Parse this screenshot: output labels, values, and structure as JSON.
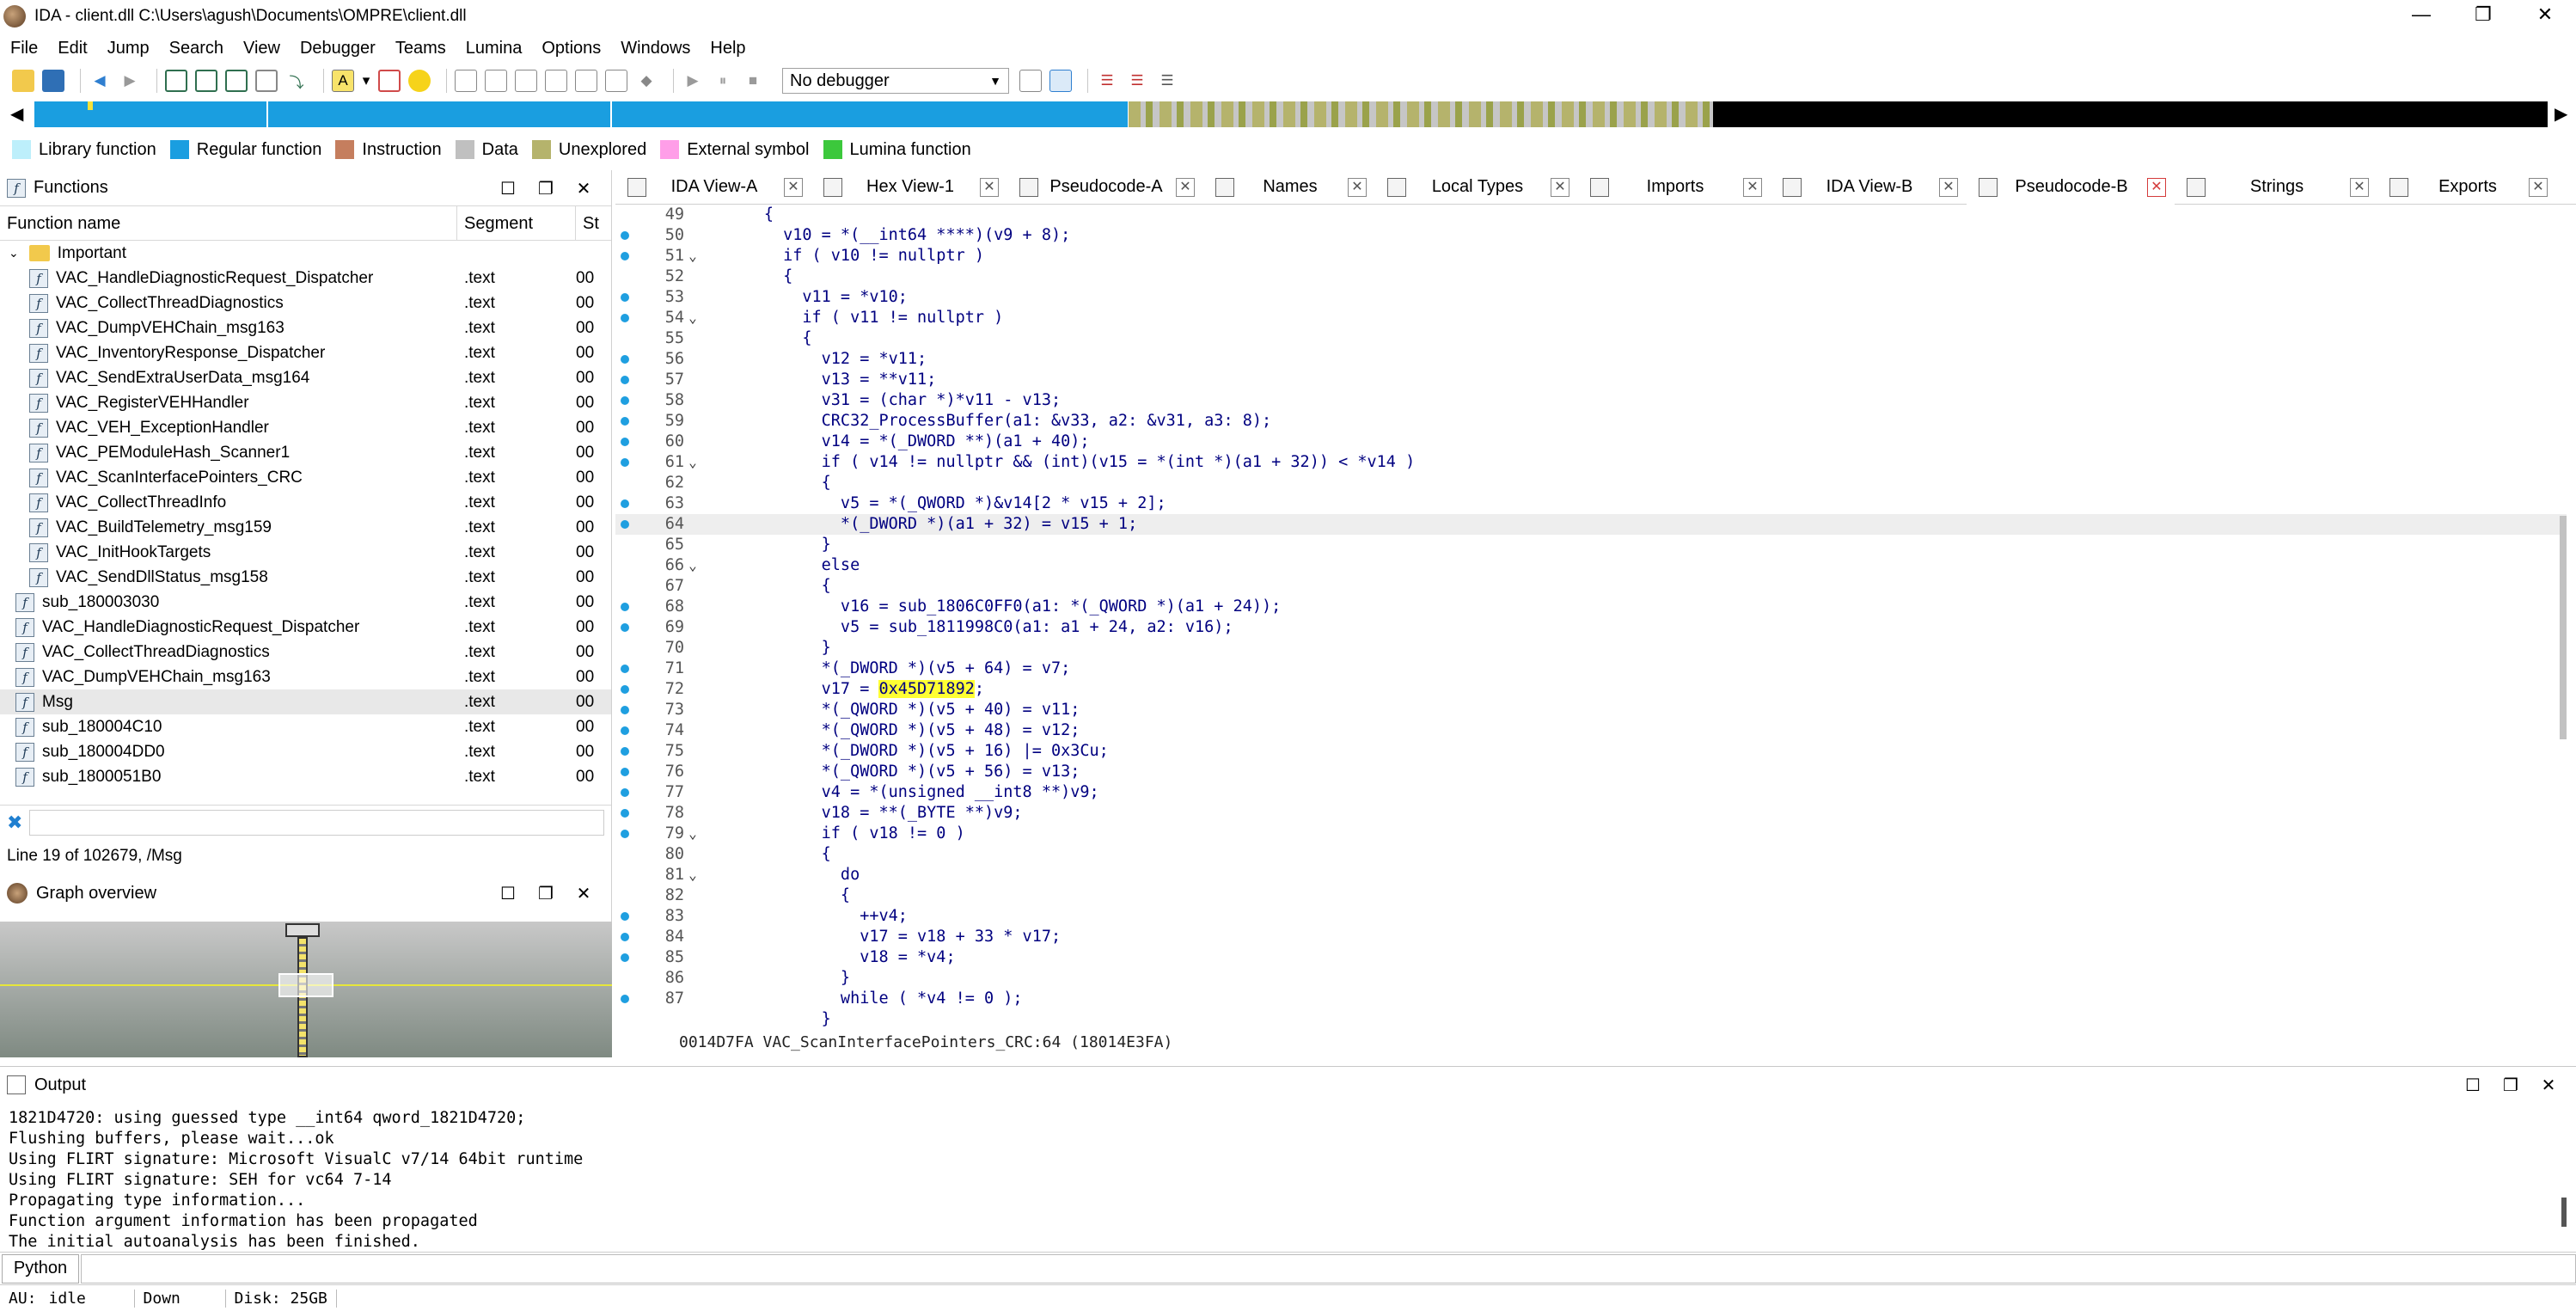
{
  "window": {
    "title": "IDA - client.dll C:\\Users\\agush\\Documents\\OMPRE\\client.dll",
    "controls": [
      "—",
      "❐",
      "✕"
    ]
  },
  "menu": [
    "File",
    "Edit",
    "Jump",
    "Search",
    "View",
    "Debugger",
    "Teams",
    "Lumina",
    "Options",
    "Windows",
    "Help"
  ],
  "toolbar": {
    "debugger_select": "No debugger"
  },
  "legend": [
    {
      "label": "Library function",
      "color": "#bdeffb"
    },
    {
      "label": "Regular function",
      "color": "#1a9ee0"
    },
    {
      "label": "Instruction",
      "color": "#c57e5e"
    },
    {
      "label": "Data",
      "color": "#c0c0c0"
    },
    {
      "label": "Unexplored",
      "color": "#b5b36c"
    },
    {
      "label": "External symbol",
      "color": "#ff9ee8"
    },
    {
      "label": "Lumina function",
      "color": "#3cc83c"
    }
  ],
  "functions_panel": {
    "title": "Functions",
    "columns": [
      "Function name",
      "Segment",
      "St"
    ],
    "folder": "Important",
    "rows": [
      {
        "name": "VAC_HandleDiagnosticRequest_Dispatcher",
        "seg": ".text",
        "st": "00",
        "indent": 2
      },
      {
        "name": "VAC_CollectThreadDiagnostics",
        "seg": ".text",
        "st": "00",
        "indent": 2
      },
      {
        "name": "VAC_DumpVEHChain_msg163",
        "seg": ".text",
        "st": "00",
        "indent": 2
      },
      {
        "name": "VAC_InventoryResponse_Dispatcher",
        "seg": ".text",
        "st": "00",
        "indent": 2
      },
      {
        "name": "VAC_SendExtraUserData_msg164",
        "seg": ".text",
        "st": "00",
        "indent": 2
      },
      {
        "name": "VAC_RegisterVEHHandler",
        "seg": ".text",
        "st": "00",
        "indent": 2
      },
      {
        "name": "VAC_VEH_ExceptionHandler",
        "seg": ".text",
        "st": "00",
        "indent": 2
      },
      {
        "name": "VAC_PEModuleHash_Scanner1",
        "seg": ".text",
        "st": "00",
        "indent": 2
      },
      {
        "name": "VAC_ScanInterfacePointers_CRC",
        "seg": ".text",
        "st": "00",
        "indent": 2
      },
      {
        "name": "VAC_CollectThreadInfo",
        "seg": ".text",
        "st": "00",
        "indent": 2
      },
      {
        "name": "VAC_BuildTelemetry_msg159",
        "seg": ".text",
        "st": "00",
        "indent": 2
      },
      {
        "name": "VAC_InitHookTargets",
        "seg": ".text",
        "st": "00",
        "indent": 2
      },
      {
        "name": "VAC_SendDllStatus_msg158",
        "seg": ".text",
        "st": "00",
        "indent": 2
      },
      {
        "name": "sub_180003030",
        "seg": ".text",
        "st": "00",
        "indent": 1
      },
      {
        "name": "VAC_HandleDiagnosticRequest_Dispatcher",
        "seg": ".text",
        "st": "00",
        "indent": 1
      },
      {
        "name": "VAC_CollectThreadDiagnostics",
        "seg": ".text",
        "st": "00",
        "indent": 1
      },
      {
        "name": "VAC_DumpVEHChain_msg163",
        "seg": ".text",
        "st": "00",
        "indent": 1
      },
      {
        "name": "Msg",
        "seg": ".text",
        "st": "00",
        "indent": 1,
        "selected": true
      },
      {
        "name": "sub_180004C10",
        "seg": ".text",
        "st": "00",
        "indent": 1
      },
      {
        "name": "sub_180004DD0",
        "seg": ".text",
        "st": "00",
        "indent": 1
      },
      {
        "name": "sub_1800051B0",
        "seg": ".text",
        "st": "00",
        "indent": 1
      }
    ],
    "status": "Line 19 of 102679, /Msg"
  },
  "graph_panel": {
    "title": "Graph overview"
  },
  "tabs": [
    {
      "label": "IDA View-A",
      "active": false
    },
    {
      "label": "Hex View-1",
      "active": false
    },
    {
      "label": "Pseudocode-A",
      "active": false
    },
    {
      "label": "Names",
      "active": false
    },
    {
      "label": "Local Types",
      "active": false
    },
    {
      "label": "Imports",
      "active": false
    },
    {
      "label": "IDA View-B",
      "active": false
    },
    {
      "label": "Pseudocode-B",
      "active": true
    },
    {
      "label": "Strings",
      "active": false
    },
    {
      "label": "Exports",
      "active": false
    }
  ],
  "code": [
    {
      "n": "49",
      "dot": false,
      "fold": "",
      "t": "      {"
    },
    {
      "n": "50",
      "dot": true,
      "fold": "",
      "t": "        v10 = *(__int64 ****)(v9 + 8);"
    },
    {
      "n": "51",
      "dot": true,
      "fold": "⌄",
      "t": "        if ( v10 != nullptr )"
    },
    {
      "n": "52",
      "dot": false,
      "fold": "",
      "t": "        {"
    },
    {
      "n": "53",
      "dot": true,
      "fold": "",
      "t": "          v11 = *v10;"
    },
    {
      "n": "54",
      "dot": true,
      "fold": "⌄",
      "t": "          if ( v11 != nullptr )"
    },
    {
      "n": "55",
      "dot": false,
      "fold": "",
      "t": "          {"
    },
    {
      "n": "56",
      "dot": true,
      "fold": "",
      "t": "            v12 = *v11;"
    },
    {
      "n": "57",
      "dot": true,
      "fold": "",
      "t": "            v13 = **v11;"
    },
    {
      "n": "58",
      "dot": true,
      "fold": "",
      "t": "            v31 = (char *)*v11 - v13;"
    },
    {
      "n": "59",
      "dot": true,
      "fold": "",
      "t": "            CRC32_ProcessBuffer(a1: &v33, a2: &v31, a3: 8);"
    },
    {
      "n": "60",
      "dot": true,
      "fold": "",
      "t": "            v14 = *(_DWORD **)(a1 + 40);"
    },
    {
      "n": "61",
      "dot": true,
      "fold": "⌄",
      "t": "            if ( v14 != nullptr && (int)(v15 = *(int *)(a1 + 32)) < *v14 )"
    },
    {
      "n": "62",
      "dot": false,
      "fold": "",
      "t": "            {"
    },
    {
      "n": "63",
      "dot": true,
      "fold": "",
      "t": "              v5 = *(_QWORD *)&v14[2 * v15 + 2];"
    },
    {
      "n": "64",
      "dot": true,
      "fold": "",
      "t": "              *(_DWORD *)(a1 + 32) = v15 + 1;",
      "cur": true
    },
    {
      "n": "65",
      "dot": false,
      "fold": "",
      "t": "            }"
    },
    {
      "n": "66",
      "dot": false,
      "fold": "⌄",
      "t": "            else"
    },
    {
      "n": "67",
      "dot": false,
      "fold": "",
      "t": "            {"
    },
    {
      "n": "68",
      "dot": true,
      "fold": "",
      "t": "              v16 = sub_1806C0FF0(a1: *(_QWORD *)(a1 + 24));"
    },
    {
      "n": "69",
      "dot": true,
      "fold": "",
      "t": "              v5 = sub_1811998C0(a1: a1 + 24, a2: v16);"
    },
    {
      "n": "70",
      "dot": false,
      "fold": "",
      "t": "            }"
    },
    {
      "n": "71",
      "dot": true,
      "fold": "",
      "t": "            *(_DWORD *)(v5 + 64) = v7;"
    },
    {
      "n": "72",
      "dot": true,
      "fold": "",
      "t": "            v17 = ",
      "hl": "0x45D71892",
      "rest": ";"
    },
    {
      "n": "73",
      "dot": true,
      "fold": "",
      "t": "            *(_QWORD *)(v5 + 40) = v11;"
    },
    {
      "n": "74",
      "dot": true,
      "fold": "",
      "t": "            *(_QWORD *)(v5 + 48) = v12;"
    },
    {
      "n": "75",
      "dot": true,
      "fold": "",
      "t": "            *(_DWORD *)(v5 + 16) |= 0x3Cu;"
    },
    {
      "n": "76",
      "dot": true,
      "fold": "",
      "t": "            *(_QWORD *)(v5 + 56) = v13;"
    },
    {
      "n": "77",
      "dot": true,
      "fold": "",
      "t": "            v4 = *(unsigned __int8 **)v9;"
    },
    {
      "n": "78",
      "dot": true,
      "fold": "",
      "t": "            v18 = **(_BYTE **)v9;"
    },
    {
      "n": "79",
      "dot": true,
      "fold": "⌄",
      "t": "            if ( v18 != 0 )"
    },
    {
      "n": "80",
      "dot": false,
      "fold": "",
      "t": "            {"
    },
    {
      "n": "81",
      "dot": false,
      "fold": "⌄",
      "t": "              do"
    },
    {
      "n": "82",
      "dot": false,
      "fold": "",
      "t": "              {"
    },
    {
      "n": "83",
      "dot": true,
      "fold": "",
      "t": "                ++v4;"
    },
    {
      "n": "84",
      "dot": true,
      "fold": "",
      "t": "                v17 = v18 + 33 * v17;"
    },
    {
      "n": "85",
      "dot": true,
      "fold": "",
      "t": "                v18 = *v4;"
    },
    {
      "n": "86",
      "dot": false,
      "fold": "",
      "t": "              }"
    },
    {
      "n": "87",
      "dot": true,
      "fold": "",
      "t": "              while ( *v4 != 0 );"
    },
    {
      "n": "",
      "dot": false,
      "fold": "",
      "t": "            }"
    }
  ],
  "code_status": "0014D7FA VAC_ScanInterfacePointers_CRC:64 (18014E3FA)",
  "output": {
    "title": "Output",
    "lines": "1821D4720: using guessed type __int64 qword_1821D4720;\nFlushing buffers, please wait...ok\nUsing FLIRT signature: Microsoft VisualC v7/14 64bit runtime\nUsing FLIRT signature: SEH for vc64 7-14\nPropagating type information...\nFunction argument information has been propagated\nThe initial autoanalysis has been finished."
  },
  "python_button": "Python",
  "statusbar": {
    "au": "AU:",
    "state": "idle",
    "dir": "Down",
    "disk": "Disk: 25GB"
  }
}
